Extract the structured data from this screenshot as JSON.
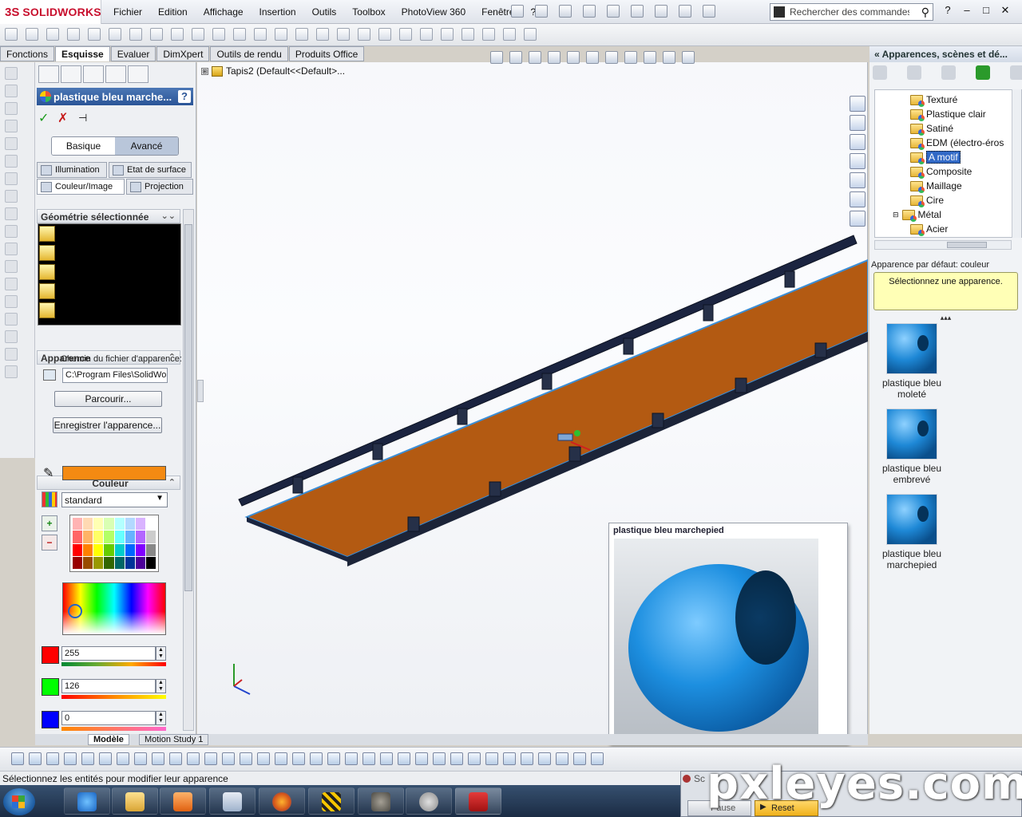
{
  "app": {
    "logo_prefix": "3S",
    "logo_name": "SOLIDWORKS"
  },
  "menu": [
    "Fichier",
    "Edition",
    "Affichage",
    "Insertion",
    "Outils",
    "Toolbox",
    "PhotoView 360",
    "Fenêtre",
    "?"
  ],
  "search": {
    "placeholder": "Rechercher des commandes",
    "value": "Rechercher des commandes"
  },
  "window_controls": [
    "?",
    "–",
    "□",
    "✕"
  ],
  "cm_tabs": [
    "Fonctions",
    "Esquisse",
    "Evaluer",
    "DimXpert",
    "Outils de rendu",
    "Produits Office"
  ],
  "cm_tabs_active": "Esquisse",
  "property_manager": {
    "title": "plastique bleu marche...",
    "help": "?",
    "ok": "✓",
    "cancel": "✗",
    "pin": "⊣",
    "mode_basic": "Basique",
    "mode_advanced": "Avancé",
    "tab_illumination": "Illumination",
    "tab_surface": "Etat de surface",
    "tab_color_image": "Couleur/Image",
    "tab_projection": "Projection",
    "geometry_header": "Géométrie sélectionnée",
    "appearance_header": "Apparence",
    "appearance_path_label": "Chemin du fichier d'apparence:",
    "appearance_path": "C:\\Program Files\\SolidWor",
    "browse": "Parcourir...",
    "save": "Enregistrer l'apparence...",
    "color_header": "Couleur",
    "color_value": "#f48a12",
    "color_mode": "standard",
    "red": "255",
    "green": "126",
    "blue": "0"
  },
  "palette_colors": [
    "#ffb3b3",
    "#ffd9b3",
    "#ffffb3",
    "#d9ffb3",
    "#b3ffff",
    "#b3d9ff",
    "#d9b3ff",
    "#ffffff",
    "#ff6666",
    "#ffb366",
    "#ffff66",
    "#b3ff66",
    "#66ffff",
    "#66b3ff",
    "#b366ff",
    "#cccccc",
    "#ff0000",
    "#ff8000",
    "#ffff00",
    "#66cc00",
    "#00cccc",
    "#0066ff",
    "#8000ff",
    "#888888",
    "#990000",
    "#994c00",
    "#999900",
    "#336600",
    "#006666",
    "#003399",
    "#4c0099",
    "#000000"
  ],
  "tree": {
    "expander": "⊞",
    "root": "Tapis2  (Default<<Default>..."
  },
  "right_panel": {
    "title": "« Apparences, scènes et dé...",
    "items": [
      {
        "label": "Texturé",
        "indent": 1,
        "selected": false
      },
      {
        "label": "Plastique clair",
        "indent": 1,
        "selected": false
      },
      {
        "label": "Satiné",
        "indent": 1,
        "selected": false
      },
      {
        "label": "EDM (électro-éros",
        "indent": 1,
        "selected": false
      },
      {
        "label": "A motif",
        "indent": 1,
        "selected": true
      },
      {
        "label": "Composite",
        "indent": 1,
        "selected": false
      },
      {
        "label": "Maillage",
        "indent": 1,
        "selected": false
      },
      {
        "label": "Cire",
        "indent": 1,
        "selected": false
      },
      {
        "label": "Métal",
        "indent": 0,
        "selected": false
      },
      {
        "label": "Acier",
        "indent": 1,
        "selected": false
      }
    ],
    "default_label": "Apparence par défaut: couleur",
    "hint": "Sélectionnez une apparence.",
    "split": "▴▴▴",
    "thumbnails": [
      {
        "line1": "plastique bleu",
        "line2": "moleté"
      },
      {
        "line1": "plastique bleu",
        "line2": "embrevé"
      },
      {
        "line1": "plastique bleu",
        "line2": "marchepied"
      }
    ]
  },
  "preview": {
    "title": "plastique bleu marchepied"
  },
  "bottom_tabs": [
    "Modèle",
    "Motion Study 1"
  ],
  "status": "Sélectionnez les entités pour modifier leur apparence",
  "sim_window": {
    "title": "Sc",
    "pause": "Pause",
    "reset": "Reset"
  },
  "watermark": "pxleyes.com"
}
